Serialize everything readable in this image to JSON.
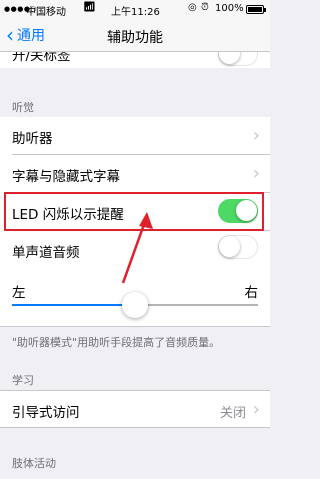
{
  "status_bar": {
    "signal": "●●●●○",
    "carrier": "中国移动",
    "time": "上午11:26",
    "battery": "100%",
    "battery_level": 1.0
  },
  "nav": {
    "back_label": "通用",
    "title": "辅助功能"
  },
  "top_row": {
    "label": "开/关标签",
    "toggle_on": false
  },
  "hearing": {
    "header": "听觉",
    "items": [
      {
        "label": "助听器"
      },
      {
        "label": "字幕与隐藏式字幕"
      }
    ],
    "led_flash": {
      "label": "LED 闪烁以示提醒",
      "toggle_on": true
    },
    "mono_audio": {
      "label": "单声道音频",
      "toggle_on": false
    },
    "balance": {
      "left": "左",
      "right": "右",
      "value": 0.5
    },
    "note": "\"助听器模式\"用助听手段提高了音频质量。"
  },
  "learning": {
    "header": "学习",
    "guided_access": {
      "label": "引导式访问",
      "value": "关闭"
    }
  },
  "interaction": {
    "header": "肢体活动"
  },
  "colors": {
    "accent": "#007aff",
    "switch_on": "#4cd964",
    "highlight": "#e0202a"
  }
}
